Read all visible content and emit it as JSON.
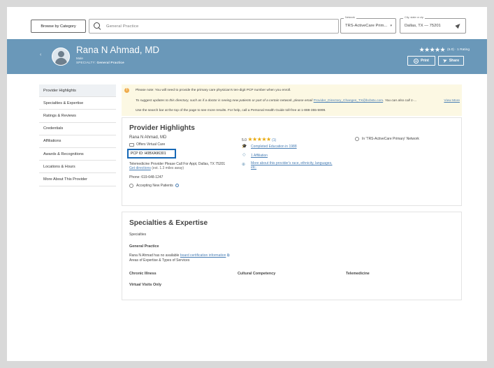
{
  "topbar": {
    "browse_label": "Browse by Category",
    "search_value": "General Practice",
    "network_legend": "Network",
    "network_value": "TRS-ActiveCare Prim...",
    "location_legend": "City, state or zip",
    "location_value": "Dallas, TX — 75201"
  },
  "provider": {
    "name": "Rana N Ahmad, MD",
    "gender": "Male",
    "specialty_label": "SPECIALTY:",
    "specialty": "General Practice",
    "rating_stars": "★★★★★",
    "rating_text": "(5.0) · 1 Rating",
    "print_label": "Print",
    "share_label": "Share"
  },
  "nav": {
    "items": [
      "Provider Highlights",
      "Specialties & Expertise",
      "Ratings & Reviews",
      "Credentials",
      "Affiliations",
      "Awards & Recognitions",
      "Locations & Hours",
      "More About This Provider"
    ]
  },
  "notice": {
    "icon": "!",
    "line1": "Please note: You will need to provide the primary care physician's ten-digit PCP number when you enroll.",
    "line2": "To suggest updates to this directory, such as if a doctor is seeing new patients or part of a certain network, please email",
    "email": "Provider_Directory_Changes_TX@bcbstx.com",
    "line2_tail": ". You can also call 1-...",
    "view_more": "View More",
    "line3": "Use the search bar at the top of the page to see more results. For help, call a Personal Health Guide toll-free at 1-888-355-5999."
  },
  "highlights": {
    "title": "Provider Highlights",
    "name": "Rana N Ahmad, MD",
    "virtual_care": "Offers Virtual Care",
    "pcp_id": "PCP ID: H0BXA96301",
    "telemedicine": "Telemedicine Provider Please Call For Appt, Dallas, TX 75201",
    "directions_link": "Get directions",
    "directions_tail": "(est. 1.3 miles away)",
    "phone": "Phone: 619-648-1247",
    "accepting": "Accepting New Patients",
    "rating_value": "5.0",
    "stars": "★★★★★",
    "rating_count": "(1)",
    "education": "Completed Education in 1988",
    "affiliation": "1 Affiliation",
    "more_about": "More about this provider's race, ethnicity, languages,",
    "more_about2": "etc.",
    "network": "In 'TRS-ActiveCare Primary' Network"
  },
  "specialties": {
    "title": "Specialties & Expertise",
    "label": "Specialties",
    "specialty": "General Practice",
    "cert_text": "Rana N Ahmad has no available",
    "cert_link": "board certification information",
    "areas_label": "Areas of Expertise & Types of Services",
    "col1": "Chronic Illness",
    "col2": "Cultural Competency",
    "col3": "Telemedicine",
    "row2": "Virtual Visits Only"
  }
}
